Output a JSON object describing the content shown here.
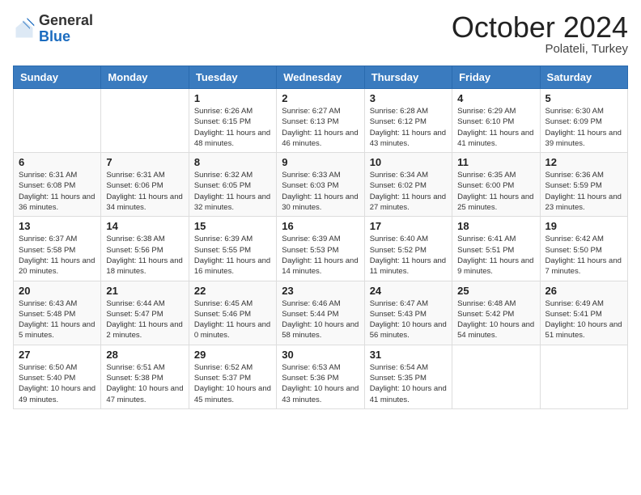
{
  "logo": {
    "line1": "General",
    "line2": "Blue"
  },
  "header": {
    "month": "October 2024",
    "location": "Polateli, Turkey"
  },
  "weekdays": [
    "Sunday",
    "Monday",
    "Tuesday",
    "Wednesday",
    "Thursday",
    "Friday",
    "Saturday"
  ],
  "weeks": [
    [
      {
        "day": "",
        "info": ""
      },
      {
        "day": "",
        "info": ""
      },
      {
        "day": "1",
        "info": "Sunrise: 6:26 AM\nSunset: 6:15 PM\nDaylight: 11 hours and 48 minutes."
      },
      {
        "day": "2",
        "info": "Sunrise: 6:27 AM\nSunset: 6:13 PM\nDaylight: 11 hours and 46 minutes."
      },
      {
        "day": "3",
        "info": "Sunrise: 6:28 AM\nSunset: 6:12 PM\nDaylight: 11 hours and 43 minutes."
      },
      {
        "day": "4",
        "info": "Sunrise: 6:29 AM\nSunset: 6:10 PM\nDaylight: 11 hours and 41 minutes."
      },
      {
        "day": "5",
        "info": "Sunrise: 6:30 AM\nSunset: 6:09 PM\nDaylight: 11 hours and 39 minutes."
      }
    ],
    [
      {
        "day": "6",
        "info": "Sunrise: 6:31 AM\nSunset: 6:08 PM\nDaylight: 11 hours and 36 minutes."
      },
      {
        "day": "7",
        "info": "Sunrise: 6:31 AM\nSunset: 6:06 PM\nDaylight: 11 hours and 34 minutes."
      },
      {
        "day": "8",
        "info": "Sunrise: 6:32 AM\nSunset: 6:05 PM\nDaylight: 11 hours and 32 minutes."
      },
      {
        "day": "9",
        "info": "Sunrise: 6:33 AM\nSunset: 6:03 PM\nDaylight: 11 hours and 30 minutes."
      },
      {
        "day": "10",
        "info": "Sunrise: 6:34 AM\nSunset: 6:02 PM\nDaylight: 11 hours and 27 minutes."
      },
      {
        "day": "11",
        "info": "Sunrise: 6:35 AM\nSunset: 6:00 PM\nDaylight: 11 hours and 25 minutes."
      },
      {
        "day": "12",
        "info": "Sunrise: 6:36 AM\nSunset: 5:59 PM\nDaylight: 11 hours and 23 minutes."
      }
    ],
    [
      {
        "day": "13",
        "info": "Sunrise: 6:37 AM\nSunset: 5:58 PM\nDaylight: 11 hours and 20 minutes."
      },
      {
        "day": "14",
        "info": "Sunrise: 6:38 AM\nSunset: 5:56 PM\nDaylight: 11 hours and 18 minutes."
      },
      {
        "day": "15",
        "info": "Sunrise: 6:39 AM\nSunset: 5:55 PM\nDaylight: 11 hours and 16 minutes."
      },
      {
        "day": "16",
        "info": "Sunrise: 6:39 AM\nSunset: 5:53 PM\nDaylight: 11 hours and 14 minutes."
      },
      {
        "day": "17",
        "info": "Sunrise: 6:40 AM\nSunset: 5:52 PM\nDaylight: 11 hours and 11 minutes."
      },
      {
        "day": "18",
        "info": "Sunrise: 6:41 AM\nSunset: 5:51 PM\nDaylight: 11 hours and 9 minutes."
      },
      {
        "day": "19",
        "info": "Sunrise: 6:42 AM\nSunset: 5:50 PM\nDaylight: 11 hours and 7 minutes."
      }
    ],
    [
      {
        "day": "20",
        "info": "Sunrise: 6:43 AM\nSunset: 5:48 PM\nDaylight: 11 hours and 5 minutes."
      },
      {
        "day": "21",
        "info": "Sunrise: 6:44 AM\nSunset: 5:47 PM\nDaylight: 11 hours and 2 minutes."
      },
      {
        "day": "22",
        "info": "Sunrise: 6:45 AM\nSunset: 5:46 PM\nDaylight: 11 hours and 0 minutes."
      },
      {
        "day": "23",
        "info": "Sunrise: 6:46 AM\nSunset: 5:44 PM\nDaylight: 10 hours and 58 minutes."
      },
      {
        "day": "24",
        "info": "Sunrise: 6:47 AM\nSunset: 5:43 PM\nDaylight: 10 hours and 56 minutes."
      },
      {
        "day": "25",
        "info": "Sunrise: 6:48 AM\nSunset: 5:42 PM\nDaylight: 10 hours and 54 minutes."
      },
      {
        "day": "26",
        "info": "Sunrise: 6:49 AM\nSunset: 5:41 PM\nDaylight: 10 hours and 51 minutes."
      }
    ],
    [
      {
        "day": "27",
        "info": "Sunrise: 6:50 AM\nSunset: 5:40 PM\nDaylight: 10 hours and 49 minutes."
      },
      {
        "day": "28",
        "info": "Sunrise: 6:51 AM\nSunset: 5:38 PM\nDaylight: 10 hours and 47 minutes."
      },
      {
        "day": "29",
        "info": "Sunrise: 6:52 AM\nSunset: 5:37 PM\nDaylight: 10 hours and 45 minutes."
      },
      {
        "day": "30",
        "info": "Sunrise: 6:53 AM\nSunset: 5:36 PM\nDaylight: 10 hours and 43 minutes."
      },
      {
        "day": "31",
        "info": "Sunrise: 6:54 AM\nSunset: 5:35 PM\nDaylight: 10 hours and 41 minutes."
      },
      {
        "day": "",
        "info": ""
      },
      {
        "day": "",
        "info": ""
      }
    ]
  ]
}
